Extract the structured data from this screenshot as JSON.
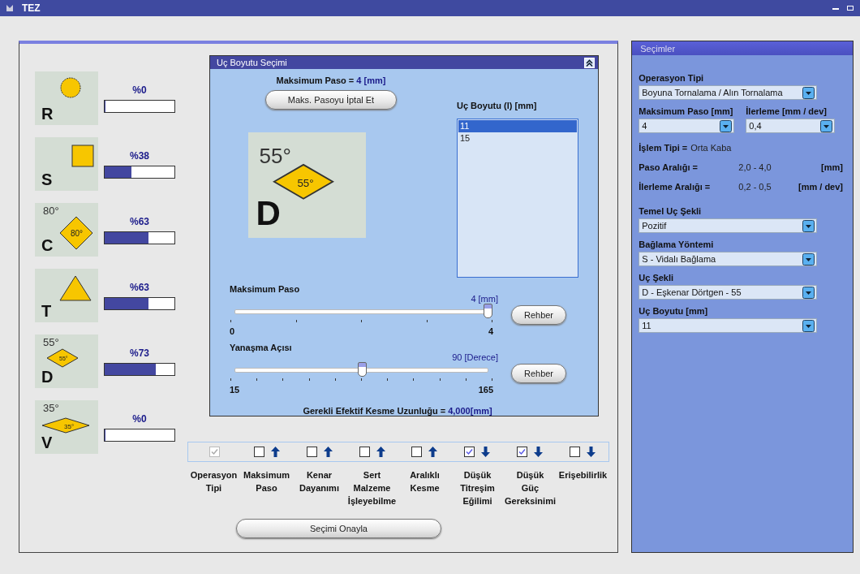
{
  "window": {
    "title": "TEZ"
  },
  "inserts": [
    {
      "letter": "R",
      "kind": "circle",
      "percent": "%0",
      "level": 0
    },
    {
      "letter": "S",
      "kind": "square",
      "percent": "%38",
      "level": 0.38
    },
    {
      "letter": "C",
      "kind": "rhombus80",
      "angle": "80°",
      "inner": "80°",
      "percent": "%63",
      "level": 0.63
    },
    {
      "letter": "T",
      "kind": "triangle",
      "percent": "%63",
      "level": 0.63
    },
    {
      "letter": "D",
      "kind": "rhombus55",
      "angle": "55°",
      "inner": "55°",
      "percent": "%73",
      "level": 0.73
    },
    {
      "letter": "V",
      "kind": "rhombus35",
      "angle": "35°",
      "inner": "35°",
      "percent": "%0",
      "level": 0
    }
  ],
  "size_panel": {
    "title": "Uç Boyutu Seçimi",
    "max_label": "Maksimum Paso = ",
    "max_value": "4 [mm]",
    "cancel_button": "Maks. Pasoyu İptal Et",
    "preview": {
      "letter": "D",
      "kind": "rhombus55",
      "angle": "55°",
      "inner": "55°"
    },
    "list_title": "Uç Boyutu (l) [mm]",
    "list": [
      {
        "label": "11",
        "selected": true
      },
      {
        "label": "15",
        "selected": false
      }
    ],
    "sliders": [
      {
        "label": "Maksimum Paso",
        "reading": "4 [mm]",
        "level": 1,
        "min": "0",
        "max": "4",
        "button": "Rehber"
      },
      {
        "label": "Yanaşma Açısı",
        "reading": "90 [Derece]",
        "level": 0.5,
        "min": "15",
        "max": "165",
        "button": "Rehber"
      }
    ],
    "result_label": "Gerekli Efektif Kesme Uzunluğu = ",
    "result_value": "4,000[mm]"
  },
  "criteria": [
    {
      "label": "Operasyon\nTipi",
      "checked": true,
      "disabled": true,
      "kind": "plain"
    },
    {
      "label": "Maksimum\nPaso",
      "checked": false,
      "disabled": false,
      "kind": "up"
    },
    {
      "label": "Kenar\nDayanımı",
      "checked": false,
      "disabled": false,
      "kind": "up"
    },
    {
      "label": "Sert\nMalzeme\nİşleyebilme",
      "checked": false,
      "disabled": false,
      "kind": "up"
    },
    {
      "label": "Aralıklı\nKesme",
      "checked": false,
      "disabled": false,
      "kind": "up"
    },
    {
      "label": "Düşük\nTitreşim\nEğilimi",
      "checked": true,
      "disabled": false,
      "kind": "down"
    },
    {
      "label": "Düşük\nGüç\nGereksinimi",
      "checked": true,
      "disabled": false,
      "kind": "down"
    },
    {
      "label": "Erişebilirlik",
      "checked": false,
      "disabled": false,
      "kind": "down"
    }
  ],
  "confirm_button": "Seçimi Onayla",
  "selections": {
    "title": "Seçimler",
    "operation": {
      "label": "Operasyon Tipi",
      "value": "Boyuna Tornalama / Alın Tornalama"
    },
    "max_depth": {
      "label": "Maksimum Paso [mm]",
      "value": "4"
    },
    "feed": {
      "label": "İlerleme [mm / dev]",
      "value": "0,4"
    },
    "process": {
      "label": "İşlem Tipi = ",
      "value": "Orta Kaba"
    },
    "ranges": [
      {
        "label": "Paso Aralığı =",
        "value": "2,0 - 4,0",
        "unit": "[mm]"
      },
      {
        "label": "İlerleme Aralığı =",
        "value": "0,2 - 0,5",
        "unit": "[mm / dev]"
      }
    ],
    "combos": [
      {
        "label": "Temel Uç Şekli",
        "value": "Pozitif"
      },
      {
        "label": "Bağlama Yöntemi",
        "value": "S - Vidalı Bağlama"
      },
      {
        "label": "Uç Şekli",
        "value": "D - Eşkenar Dörtgen - 55"
      },
      {
        "label": "Uç Boyutu [mm]",
        "value": "11"
      }
    ]
  }
}
